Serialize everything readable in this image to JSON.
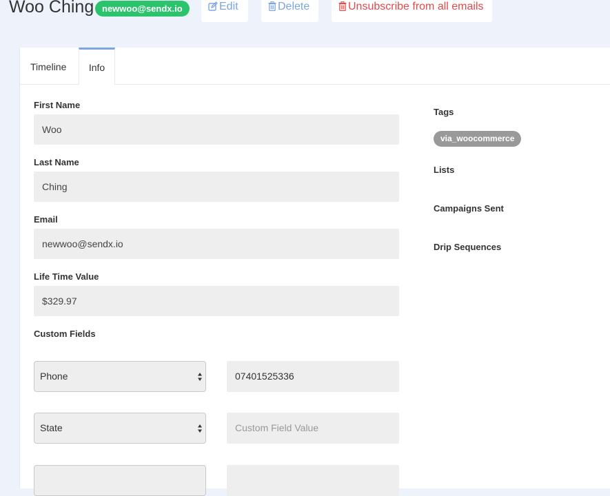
{
  "header": {
    "name": "Woo Ching",
    "email_badge": "newwoo@sendx.io",
    "edit_label": "Edit",
    "delete_label": "Delete",
    "unsubscribe_label": "Unsubscribe from all emails"
  },
  "tabs": [
    {
      "label": "Timeline",
      "active": false
    },
    {
      "label": "Info",
      "active": true
    }
  ],
  "info": {
    "first_name_label": "First Name",
    "first_name_value": "Woo",
    "last_name_label": "Last Name",
    "last_name_value": "Ching",
    "email_label": "Email",
    "email_value": "newwoo@sendx.io",
    "ltv_label": "Life Time Value",
    "ltv_value": "$329.97",
    "custom_fields_label": "Custom Fields",
    "custom_fields": [
      {
        "field": "Phone",
        "value": "07401525336",
        "placeholder": ""
      },
      {
        "field": "State",
        "value": "",
        "placeholder": "Custom Field Value"
      },
      {
        "field": "",
        "value": "",
        "placeholder": ""
      }
    ]
  },
  "sidebar": {
    "tags_label": "Tags",
    "tags": [
      "via_woocommerce"
    ],
    "lists_label": "Lists",
    "campaigns_label": "Campaigns Sent",
    "drips_label": "Drip Sequences"
  },
  "colors": {
    "badge_green": "#2bc36b",
    "link_blue": "#7aa5e0",
    "danger_red": "#e24a4a",
    "tag_gray": "#999999",
    "page_bg": "#eef3fb"
  },
  "icons": {
    "edit": "pencil-square-icon",
    "delete": "trash-icon",
    "unsubscribe": "trash-icon",
    "select": "up-down-arrows-icon"
  }
}
